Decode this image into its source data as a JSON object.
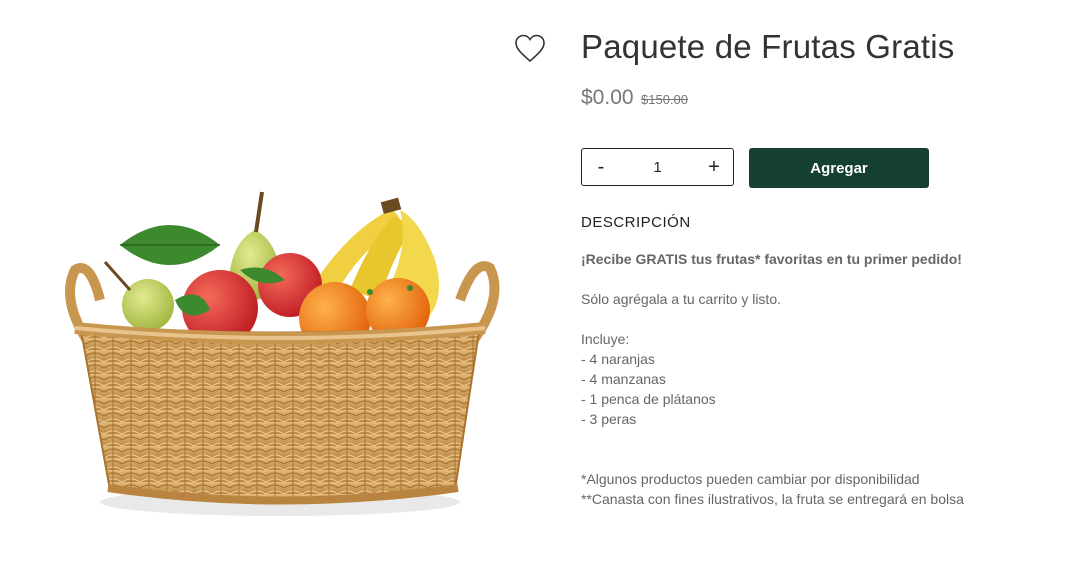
{
  "product": {
    "title": "Paquete de Frutas Gratis",
    "price": "$0.00",
    "old_price": "$150.00"
  },
  "quantity": {
    "decrement_label": "-",
    "value": "1",
    "increment_label": "+"
  },
  "add_button_label": "Agregar",
  "description": {
    "heading": "DESCRIPCIÓN",
    "highlight": "¡Recibe GRATIS tus frutas* favoritas en tu primer pedido!",
    "instruction": "Sólo agrégala a tu carrito y listo.",
    "includes_label": "Incluye:",
    "items": [
      "- 4 naranjas",
      "- 4 manzanas",
      "- 1 penca de plátanos",
      "- 3 peras"
    ],
    "note1": "*Algunos productos pueden cambiar por disponibilidad",
    "note2": "**Canasta con fines ilustrativos, la fruta se entregará en bolsa"
  },
  "colors": {
    "add_button": "#163f33",
    "basket": "#d6a867",
    "orange": "#f27a1a",
    "apple": "#d92b2b",
    "banana": "#f0d040",
    "pear": "#b8cc52",
    "leaf": "#3d8a2e"
  },
  "icons": {
    "wishlist": "heart-outline-icon"
  }
}
